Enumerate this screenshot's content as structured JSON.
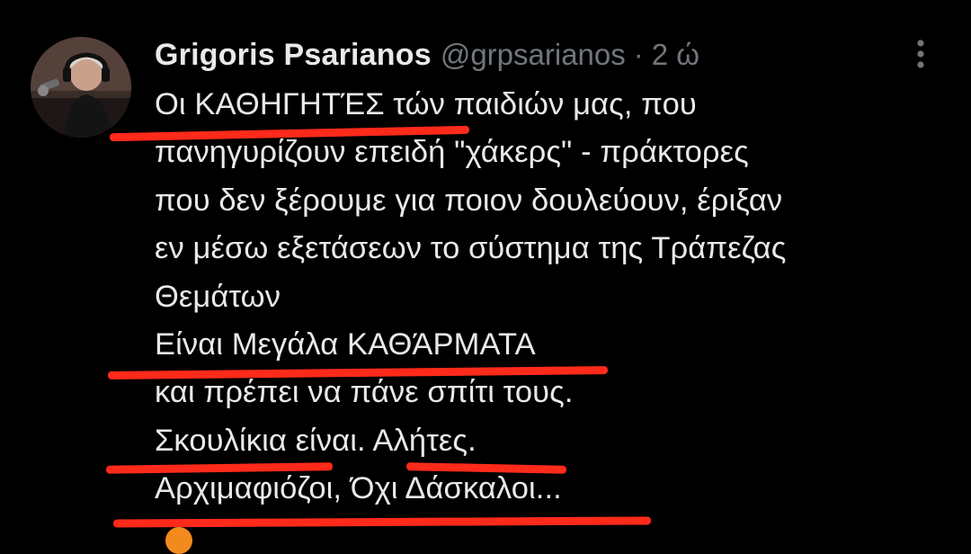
{
  "tweet": {
    "author_name": "Grigoris Psarianos",
    "handle": "@grpsarianos",
    "separator": "·",
    "time": "2 ώ",
    "avatar_alt": "avatar",
    "more_icon": "more-vertical-icon",
    "lines": [
      "Οι ΚΑΘΗΓΗΤΈΣ τών παιδιών μας, που",
      "πανηγυρίζουν επειδή \"χάκερς\" - πράκτορες",
      "που δεν ξέρουμε για ποιον δουλεύουν, έριξαν",
      "εν μέσω εξετάσεων το σύστημα της Τράπεζας",
      "Θεμάτων",
      "Είναι Μεγάλα ΚΑΘΆΡΜΑΤΑ",
      "και πρέπει να πάνε σπίτι τους.",
      "Σκουλίκια είναι. Αλήτες.",
      "Αρχιμαφιόζοι, Όχι Δάσκαλοι..."
    ]
  },
  "colors": {
    "background": "#000000",
    "text": "#e7e9ea",
    "muted": "#71767b",
    "annotation_underline": "#ff2a1a"
  }
}
